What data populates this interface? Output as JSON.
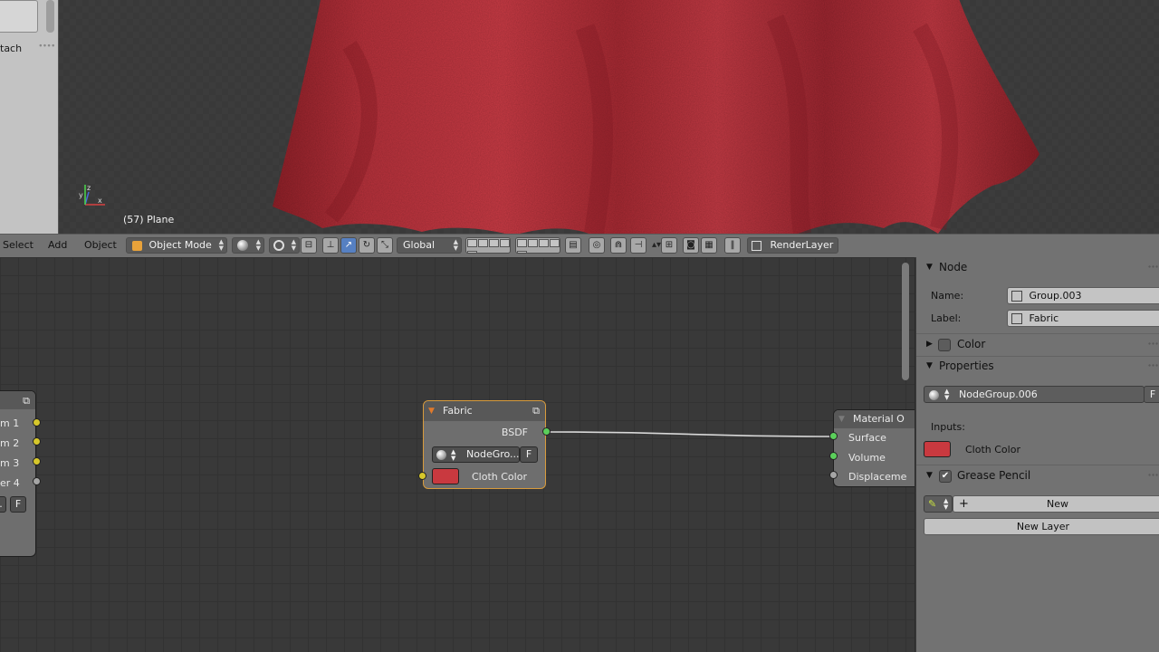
{
  "viewport": {
    "tool_shelf_label": "tach",
    "object_info": "(57) Plane",
    "axis_labels": {
      "x": "x",
      "y": "y",
      "z": "z"
    }
  },
  "header": {
    "menus": [
      "Select",
      "Add",
      "Object"
    ],
    "mode": "Object Mode",
    "transform_orientation": "Global",
    "render_layer": "RenderLayer"
  },
  "node_editor": {
    "left_node": {
      "outputs": [
        "m 1",
        "m 2",
        "m 3",
        "er 4"
      ],
      "button_f": "F",
      "button_dots": "."
    },
    "fabric_node": {
      "title": "Fabric",
      "output": "BSDF",
      "group": "NodeGro...",
      "group_f": "F",
      "input": "Cloth Color",
      "color": "#c9393f"
    },
    "material_output_node": {
      "title": "Material O",
      "inputs": [
        "Surface",
        "Volume",
        "Displaceme"
      ]
    }
  },
  "properties": {
    "node_section": {
      "title": "Node",
      "name_label": "Name:",
      "name_value": "Group.003",
      "label_label": "Label:",
      "label_value": "Fabric"
    },
    "color_section": {
      "title": "Color"
    },
    "properties_section": {
      "title": "Properties",
      "node_group": "NodeGroup.006",
      "fake_user": "F",
      "inputs_label": "Inputs:",
      "cloth_color_label": "Cloth Color",
      "cloth_color": "#c9393f"
    },
    "grease_pencil_section": {
      "title": "Grease Pencil",
      "new_button": "New",
      "new_layer_button": "New Layer"
    }
  },
  "colors": {
    "cloth_red": "#b8323c",
    "active_blue": "#5680c2",
    "socket_yellow": "#d6c72b",
    "socket_green": "#5bcf5b",
    "node_selected_outline": "#e0a040"
  }
}
